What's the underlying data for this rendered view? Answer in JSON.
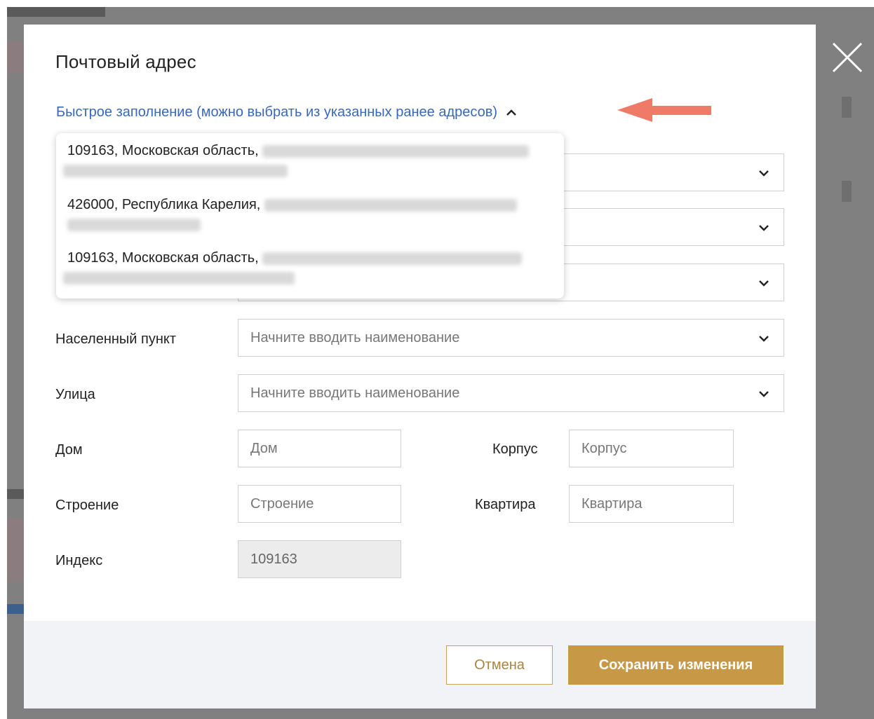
{
  "modal": {
    "title": "Почтовый адрес",
    "quick_fill_link": "Быстрое заполнение (можно выбрать из указанных ранее адресов)"
  },
  "saved_addresses": [
    {
      "text": "109163, Московская область,"
    },
    {
      "text": "426000, Республика Карелия,"
    },
    {
      "text": "109163, Московская область,"
    }
  ],
  "form": {
    "locality": {
      "label": "Населенный пункт",
      "placeholder": "Начните вводить наименование"
    },
    "street": {
      "label": "Улица",
      "placeholder": "Начните вводить наименование"
    },
    "house": {
      "label": "Дом",
      "placeholder": "Дом"
    },
    "korpus": {
      "label": "Корпус",
      "placeholder": "Корпус"
    },
    "building": {
      "label": "Строение",
      "placeholder": "Строение"
    },
    "apartment": {
      "label": "Квартира",
      "placeholder": "Квартира"
    },
    "index": {
      "label": "Индекс",
      "value": "109163"
    }
  },
  "footer": {
    "cancel_label": "Отмена",
    "save_label": "Сохранить изменения"
  },
  "colors": {
    "link": "#3a68b8",
    "accent_gold": "#c79846",
    "annotation_arrow": "#f07a68"
  }
}
